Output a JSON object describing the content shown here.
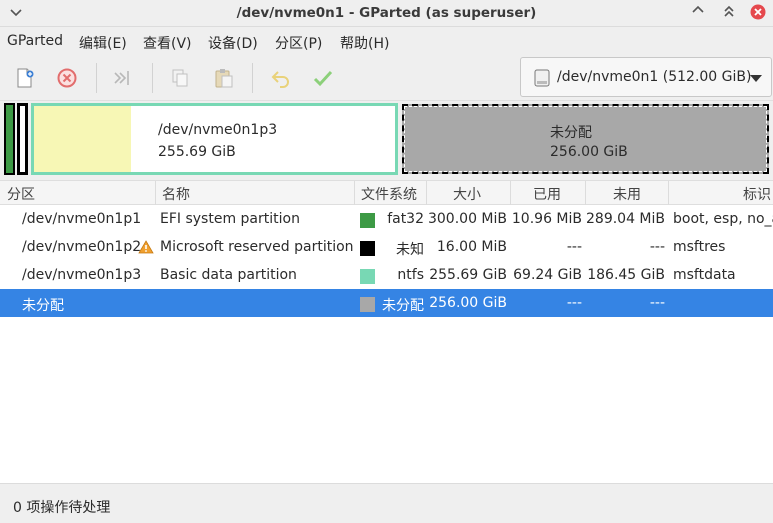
{
  "window": {
    "title": "/dev/nvme0n1 - GParted (as superuser)"
  },
  "menubar": {
    "items": [
      "GParted",
      "编辑(E)",
      "查看(V)",
      "设备(D)",
      "分区(P)",
      "帮助(H)"
    ]
  },
  "toolbar": {
    "icons": [
      "new-partition-icon",
      "delete-icon",
      "resize-move-icon",
      "copy-icon",
      "paste-icon",
      "undo-icon",
      "apply-icon"
    ],
    "device_selector": "/dev/nvme0n1 (512.00 GiB)"
  },
  "diskmap": {
    "p3_name": "/dev/nvme0n1p3",
    "p3_size": "255.69 GiB",
    "p3_used_fraction": 0.27,
    "unalloc_name": "未分配",
    "unalloc_size": "256.00 GiB"
  },
  "table": {
    "headers": [
      "分区",
      "名称",
      "文件系统",
      "大小",
      "已用",
      "未用",
      "标识"
    ],
    "rows": [
      {
        "partition": "/dev/nvme0n1p1",
        "name": "EFI system partition",
        "fs": "fat32",
        "fs_color": "#3d9a45",
        "size": "300.00 MiB",
        "used": "10.96 MiB",
        "unused": "289.04 MiB",
        "flags": "boot, esp, no_a",
        "warning": false,
        "selected": false
      },
      {
        "partition": "/dev/nvme0n1p2",
        "name": "Microsoft reserved partition",
        "fs": "未知",
        "fs_color": "#000000",
        "size": "16.00 MiB",
        "used": "---",
        "unused": "---",
        "flags": "msftres",
        "warning": true,
        "selected": false
      },
      {
        "partition": "/dev/nvme0n1p3",
        "name": "Basic data partition",
        "fs": "ntfs",
        "fs_color": "#78d8b4",
        "size": "255.69 GiB",
        "used": "69.24 GiB",
        "unused": "186.45 GiB",
        "flags": "msftdata",
        "warning": false,
        "selected": false
      },
      {
        "partition": "未分配",
        "name": "",
        "fs": "未分配",
        "fs_color": "#a8a8a8",
        "size": "256.00 GiB",
        "used": "---",
        "unused": "---",
        "flags": "",
        "warning": false,
        "selected": true
      }
    ]
  },
  "statusbar": {
    "text": "0 项操作待处理"
  },
  "colors": {
    "accent": "#3584e4",
    "ntfs": "#78d8b4",
    "used_yellow": "#f7f7b5",
    "unallocated": "#a8a8a8"
  }
}
